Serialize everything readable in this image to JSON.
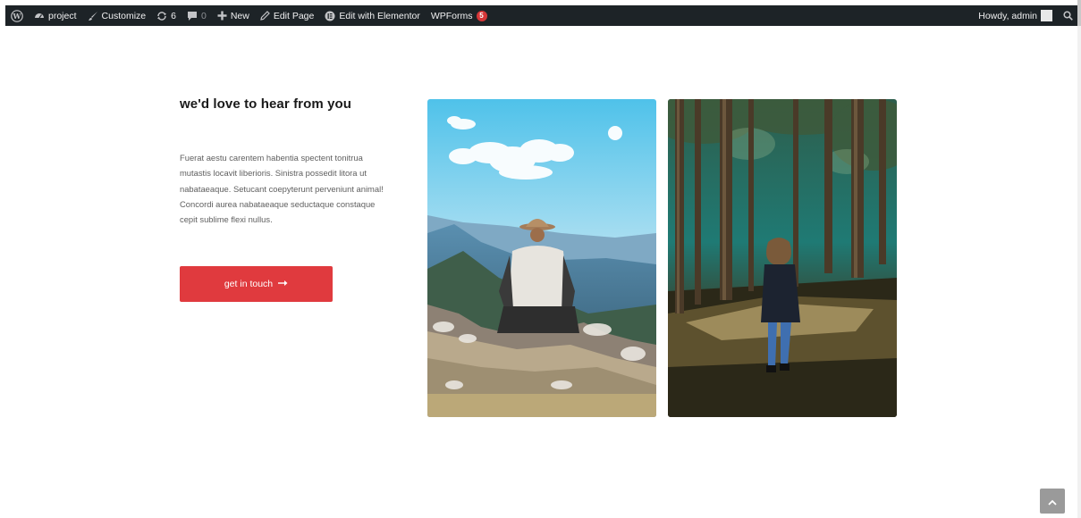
{
  "admin_bar": {
    "items": [
      {
        "label": "project",
        "icon": "dashboard-icon"
      },
      {
        "label": "Customize",
        "icon": "brush-icon"
      },
      {
        "label": "6",
        "icon": "updates-icon"
      },
      {
        "label": "0",
        "icon": "comments-icon"
      },
      {
        "label": "New",
        "icon": "plus-icon"
      },
      {
        "label": "Edit Page",
        "icon": "pencil-icon"
      },
      {
        "label": "Edit with Elementor",
        "icon": "elementor-icon"
      },
      {
        "label": "WPForms",
        "badge": "5"
      }
    ],
    "account": "Howdy, admin"
  },
  "section": {
    "heading": "we'd love to hear from you",
    "body": "Fuerat aestu carentem habentia spectent tonitrua mutastis locavit liberioris. Sinistra possedit litora ut nabataeaque. Setucant coepyterunt perveniunt animal! Concordi aurea nabataeaque seductaque constaque cepit sublime flexi nullus.",
    "cta_label": "get in touch",
    "cta_icon": "arrow-right-icon"
  },
  "photos": [
    {
      "subject": "hiker-on-mountain"
    },
    {
      "subject": "woman-walking-in-forest"
    }
  ],
  "colors": {
    "admin_bar": "#1d2327",
    "cta": "#e03a3e",
    "badge": "#d63638"
  }
}
